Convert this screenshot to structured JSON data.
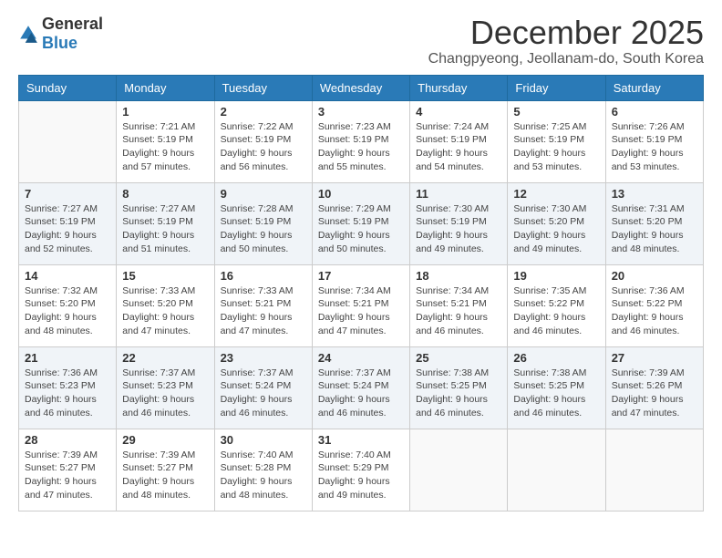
{
  "header": {
    "logo_general": "General",
    "logo_blue": "Blue",
    "month_title": "December 2025",
    "location": "Changpyeong, Jeollanam-do, South Korea"
  },
  "weekdays": [
    "Sunday",
    "Monday",
    "Tuesday",
    "Wednesday",
    "Thursday",
    "Friday",
    "Saturday"
  ],
  "weeks": [
    [
      {
        "day": "",
        "detail": ""
      },
      {
        "day": "1",
        "detail": "Sunrise: 7:21 AM\nSunset: 5:19 PM\nDaylight: 9 hours and 57 minutes."
      },
      {
        "day": "2",
        "detail": "Sunrise: 7:22 AM\nSunset: 5:19 PM\nDaylight: 9 hours and 56 minutes."
      },
      {
        "day": "3",
        "detail": "Sunrise: 7:23 AM\nSunset: 5:19 PM\nDaylight: 9 hours and 55 minutes."
      },
      {
        "day": "4",
        "detail": "Sunrise: 7:24 AM\nSunset: 5:19 PM\nDaylight: 9 hours and 54 minutes."
      },
      {
        "day": "5",
        "detail": "Sunrise: 7:25 AM\nSunset: 5:19 PM\nDaylight: 9 hours and 53 minutes."
      },
      {
        "day": "6",
        "detail": "Sunrise: 7:26 AM\nSunset: 5:19 PM\nDaylight: 9 hours and 53 minutes."
      }
    ],
    [
      {
        "day": "7",
        "detail": "Sunrise: 7:27 AM\nSunset: 5:19 PM\nDaylight: 9 hours and 52 minutes."
      },
      {
        "day": "8",
        "detail": "Sunrise: 7:27 AM\nSunset: 5:19 PM\nDaylight: 9 hours and 51 minutes."
      },
      {
        "day": "9",
        "detail": "Sunrise: 7:28 AM\nSunset: 5:19 PM\nDaylight: 9 hours and 50 minutes."
      },
      {
        "day": "10",
        "detail": "Sunrise: 7:29 AM\nSunset: 5:19 PM\nDaylight: 9 hours and 50 minutes."
      },
      {
        "day": "11",
        "detail": "Sunrise: 7:30 AM\nSunset: 5:19 PM\nDaylight: 9 hours and 49 minutes."
      },
      {
        "day": "12",
        "detail": "Sunrise: 7:30 AM\nSunset: 5:20 PM\nDaylight: 9 hours and 49 minutes."
      },
      {
        "day": "13",
        "detail": "Sunrise: 7:31 AM\nSunset: 5:20 PM\nDaylight: 9 hours and 48 minutes."
      }
    ],
    [
      {
        "day": "14",
        "detail": "Sunrise: 7:32 AM\nSunset: 5:20 PM\nDaylight: 9 hours and 48 minutes."
      },
      {
        "day": "15",
        "detail": "Sunrise: 7:33 AM\nSunset: 5:20 PM\nDaylight: 9 hours and 47 minutes."
      },
      {
        "day": "16",
        "detail": "Sunrise: 7:33 AM\nSunset: 5:21 PM\nDaylight: 9 hours and 47 minutes."
      },
      {
        "day": "17",
        "detail": "Sunrise: 7:34 AM\nSunset: 5:21 PM\nDaylight: 9 hours and 47 minutes."
      },
      {
        "day": "18",
        "detail": "Sunrise: 7:34 AM\nSunset: 5:21 PM\nDaylight: 9 hours and 46 minutes."
      },
      {
        "day": "19",
        "detail": "Sunrise: 7:35 AM\nSunset: 5:22 PM\nDaylight: 9 hours and 46 minutes."
      },
      {
        "day": "20",
        "detail": "Sunrise: 7:36 AM\nSunset: 5:22 PM\nDaylight: 9 hours and 46 minutes."
      }
    ],
    [
      {
        "day": "21",
        "detail": "Sunrise: 7:36 AM\nSunset: 5:23 PM\nDaylight: 9 hours and 46 minutes."
      },
      {
        "day": "22",
        "detail": "Sunrise: 7:37 AM\nSunset: 5:23 PM\nDaylight: 9 hours and 46 minutes."
      },
      {
        "day": "23",
        "detail": "Sunrise: 7:37 AM\nSunset: 5:24 PM\nDaylight: 9 hours and 46 minutes."
      },
      {
        "day": "24",
        "detail": "Sunrise: 7:37 AM\nSunset: 5:24 PM\nDaylight: 9 hours and 46 minutes."
      },
      {
        "day": "25",
        "detail": "Sunrise: 7:38 AM\nSunset: 5:25 PM\nDaylight: 9 hours and 46 minutes."
      },
      {
        "day": "26",
        "detail": "Sunrise: 7:38 AM\nSunset: 5:25 PM\nDaylight: 9 hours and 46 minutes."
      },
      {
        "day": "27",
        "detail": "Sunrise: 7:39 AM\nSunset: 5:26 PM\nDaylight: 9 hours and 47 minutes."
      }
    ],
    [
      {
        "day": "28",
        "detail": "Sunrise: 7:39 AM\nSunset: 5:27 PM\nDaylight: 9 hours and 47 minutes."
      },
      {
        "day": "29",
        "detail": "Sunrise: 7:39 AM\nSunset: 5:27 PM\nDaylight: 9 hours and 48 minutes."
      },
      {
        "day": "30",
        "detail": "Sunrise: 7:40 AM\nSunset: 5:28 PM\nDaylight: 9 hours and 48 minutes."
      },
      {
        "day": "31",
        "detail": "Sunrise: 7:40 AM\nSunset: 5:29 PM\nDaylight: 9 hours and 49 minutes."
      },
      {
        "day": "",
        "detail": ""
      },
      {
        "day": "",
        "detail": ""
      },
      {
        "day": "",
        "detail": ""
      }
    ]
  ]
}
